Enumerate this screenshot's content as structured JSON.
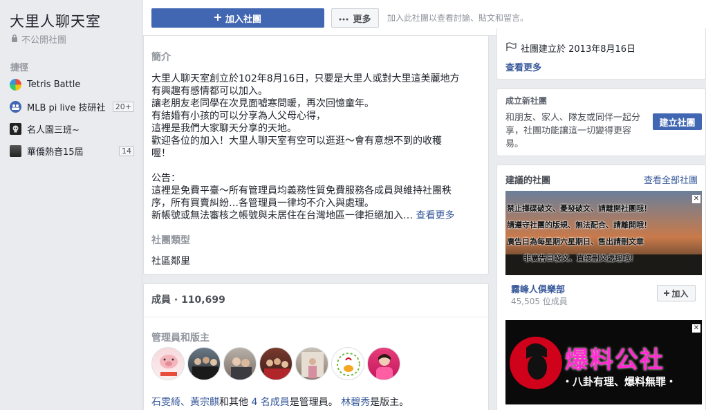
{
  "sidebar": {
    "group_title": "大里人聊天室",
    "privacy": "不公開社團",
    "shortcuts_heading": "捷徑",
    "shortcuts": [
      {
        "label": "Tetris Battle",
        "badge": ""
      },
      {
        "label": "MLB pi live 技研社",
        "badge": "20+"
      },
      {
        "label": "名人園三班~",
        "badge": ""
      },
      {
        "label": "華僑熱音15屆",
        "badge": "14"
      }
    ]
  },
  "header": {
    "join_label": "加入社團",
    "more_label": "更多",
    "join_hint": "加入此社團以查看討論、貼文和留言。"
  },
  "about": {
    "title": "簡介",
    "lines": [
      "大里人聊天室創立於102年8月16日，只要是大里人或對大里這美麗地方",
      "有興趣有感情都可以加入。",
      "讓老朋友老同學在次見面噓寒問暖，再次回憶童年。",
      "有結婚有小孩的可以分享為人父母心得，",
      "這裡是我們大家聊天分享的天地。",
      "歡迎各位的加入！大里人聊天室有空可以逛逛～會有意想不到的收穫",
      "喔！",
      "",
      "公告：",
      "這裡是免費平臺～所有管理員均義務性質免費服務各成員與維持社團秩",
      "序，所有買賣糾紛…各管理員一律均不介入與處理。",
      "新帳號或無法審核之帳號與未居住在台灣地區一律拒絕加入… "
    ],
    "see_more": "查看更多",
    "type_title": "社團類型",
    "type_value": "社區鄰里"
  },
  "members": {
    "title": "成員 · 110,699",
    "admins_title": "管理員和版主",
    "admins_line": {
      "names": "石雯綺、黃宗麒",
      "and_others": "和其他",
      "others_link": "4 名成員",
      "is_admin": "是管理員。",
      "moderator_name": "林碧秀",
      "is_moderator": "是版主。"
    }
  },
  "right": {
    "created": "社團建立於 2013年8月16日",
    "see_more": "查看更多",
    "create_title": "成立新社團",
    "create_desc": "和朋友、家人、隊友或同伴一起分享，社團功能讓這一切變得更容易。",
    "create_button": "建立社團",
    "suggest_title": "建議的社團",
    "see_all": "查看全部社團",
    "suggestions": [
      {
        "name": "霧峰人俱樂部",
        "members": "45,505 位成員",
        "join": "加入",
        "banner_lines": [
          "禁止擇碟破文、憂發破文、請離開社團哦！",
          "請遵守社團的版規、無法配合、請離開哦！",
          "廣告日為每星期六星期日、售出請刪文章",
          "非廣告日發文、直接刪文處理哦！"
        ]
      },
      {
        "name": "",
        "members": "",
        "join": "",
        "banner_title": "爆料公社",
        "banner_sub": "・八卦有理、爆料無罪・"
      }
    ]
  },
  "colors": {
    "brand": "#4267b2",
    "link": "#365899",
    "muted": "#90949c"
  }
}
